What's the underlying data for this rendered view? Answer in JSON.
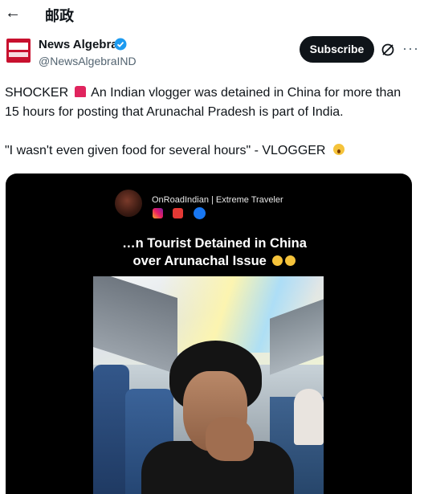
{
  "topbar": {
    "back_glyph": "←",
    "title": "邮政"
  },
  "post": {
    "author_name": "News Algebra",
    "author_handle": "@NewsAlgebraIND",
    "subscribe_label": "Subscribe",
    "more_glyph": "···",
    "text_part1": "SHOCKER",
    "text_part2": "An Indian vlogger was detained in China for more than 15 hours for posting that Arunachal Pradesh is part of India.",
    "text_line2": "\"I wasn't even given food for several hours\" - VLOGGER",
    "icons": [
      "back-arrow-icon",
      "verified-badge-icon",
      "siren-emoji",
      "scream-emoji",
      "grok-icon",
      "more-icon"
    ]
  },
  "media": {
    "channel_name": "OnRoadIndian | Extreme Traveler",
    "social_icons": [
      "instagram-icon",
      "youtube-icon",
      "facebook-icon"
    ],
    "title_line1": "…n Tourist Detained in China",
    "title_line2": "over Arunachal Issue",
    "colors": {
      "background": "#000000",
      "title": "#ffffff"
    }
  },
  "colors": {
    "accent_verified": "#1d9bf0",
    "subscribe_bg": "#0f1419",
    "handle": "#536471"
  }
}
